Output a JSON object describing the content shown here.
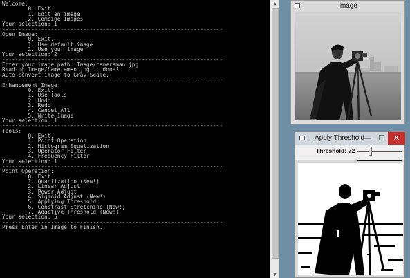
{
  "console": {
    "lines": [
      "Welcome:",
      "        0. Exit.",
      "        1. Edit an image",
      "        2. Combine Images",
      "Your selection: 1",
      "--------------------------------------------------------------------",
      "Open Image:",
      "        0. Exit.",
      "        1. Use default image",
      "        2. Use your image",
      "Your selection: 2",
      "--------------------------------------------------------------------",
      "Enter your image path: Image/cameraman.jpg",
      "Reading Image/cameraman.jpg... done!",
      "Auto convert image to Gray Scale.",
      "--------------------------------------------------------------------",
      "Enhancement Image:",
      "        0. Exit.",
      "        1. Use Tools",
      "        2. Undo",
      "        3. Redo",
      "        4. Cancel All",
      "        5. Write Image",
      "Your selection: 1",
      "--------------------------------------------------------------------",
      "Tools:",
      "        0. Exit.",
      "        1. Point Operation",
      "        2. Histogram Equalization",
      "        3. Operator Filter",
      "        4. Frequency Filter",
      "Your selection: 1",
      "--------------------------------------------------------------------",
      "Point Operation:",
      "        0. Exit.",
      "        1. Quantization (New!)",
      "        2. Linear Adjust",
      "        3. Power Adjust",
      "        4. Sigmoid Adjust (New!)",
      "        5. Applying Threshold",
      "        6. Constrast Stretching (New!)",
      "        7. Adaptive Threshold (New!)",
      "Your selection: 5",
      "--------------------------------------------------------------------",
      "Press Enter in Image to Finish."
    ]
  },
  "image_window": {
    "title": "Image",
    "icon": "window-app-icon",
    "content": "cameraman-grayscale-photo"
  },
  "threshold_window": {
    "title": "Apply Threshold",
    "icon": "window-app-icon",
    "controls": {
      "minimize": "—",
      "maximize": "☐",
      "close": "✕"
    },
    "trackbar_label": "Threshold:",
    "trackbar_value": "72",
    "slider_fraction": 0.28,
    "content": "cameraman-threshold-binary-photo"
  },
  "colors": {
    "console_bg": "#000000",
    "console_text": "#d0d0d0",
    "close_button": "#c7312d"
  }
}
